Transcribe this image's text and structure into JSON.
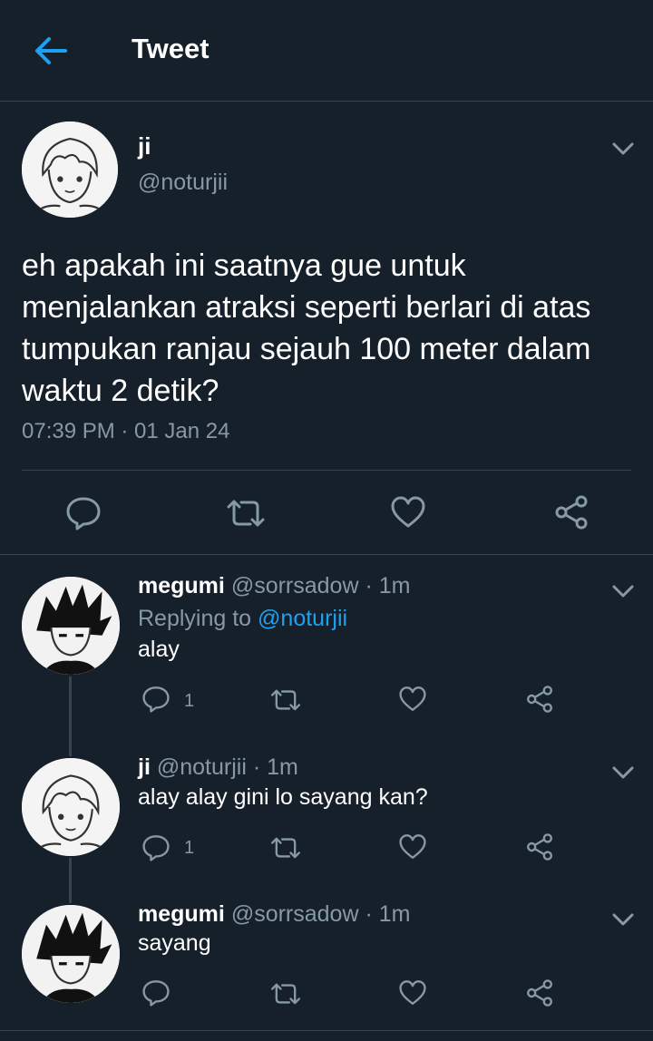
{
  "header": {
    "title": "Tweet",
    "back_icon": "arrow-left-icon",
    "accent": "#1da1f2"
  },
  "main_tweet": {
    "name": "ji",
    "handle": "@noturjii",
    "text": "eh apakah ini saatnya gue untuk menjalankan atraksi seperti berlari di atas tumpukan ranjau sejauh 100 meter dalam waktu 2 detik?",
    "timestamp": "07:39 PM · 01 Jan 24",
    "actions": [
      "reply-icon",
      "retweet-icon",
      "like-icon",
      "share-icon"
    ]
  },
  "replies": [
    {
      "name": "megumi",
      "handle_time": "@sorrsadow · 1m",
      "replying_label": "Replying to",
      "replying_handle": "@noturjii",
      "text": "alay",
      "reply_count": "1"
    },
    {
      "name": "ji",
      "handle_time": "@noturjii · 1m",
      "text": "alay alay gini lo sayang kan?",
      "reply_count": "1"
    },
    {
      "name": "megumi",
      "handle_time": "@sorrsadow · 1m",
      "text": "sayang",
      "reply_count": ""
    }
  ],
  "colors": {
    "background": "#15202b",
    "border": "#38444d",
    "muted": "#8899a6",
    "link": "#1da1f2"
  }
}
